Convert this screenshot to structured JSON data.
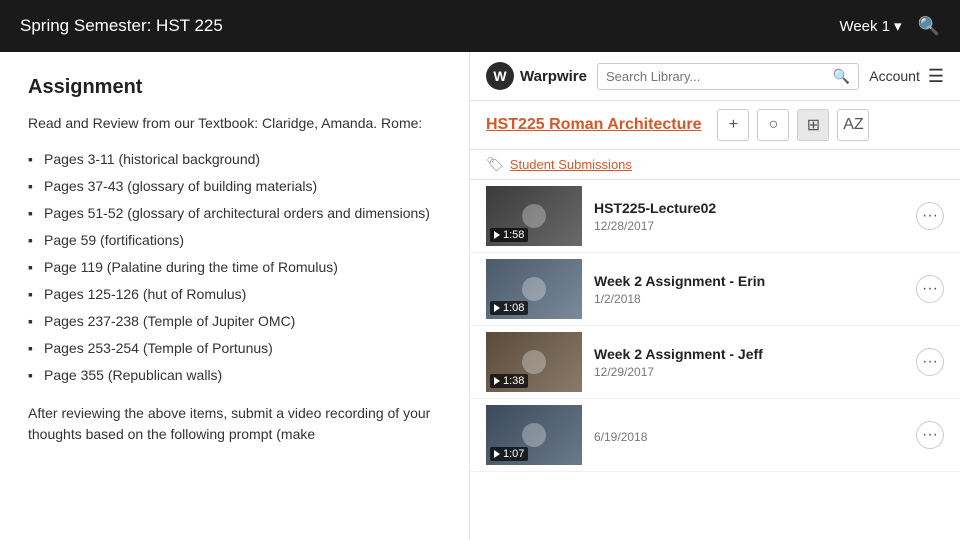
{
  "topbar": {
    "title": "Spring Semester: HST 225",
    "week_label": "Week 1",
    "chevron": "▾"
  },
  "assignment": {
    "heading": "Assignment",
    "intro": "Read and Review from our Textbook: Claridge, Amanda. Rome:",
    "pages": [
      "Pages 3-11 (historical background)",
      "Pages 37-43 (glossary of building materials)",
      "Pages 51-52 (glossary of architectural orders and dimensions)",
      "Page 59 (fortifications)",
      "Page 119 (Palatine during the time of Romulus)",
      "Pages 125-126 (hut of Romulus)",
      "Pages 237-238 (Temple of Jupiter OMC)",
      "Pages 253-254 (Temple of Portunus)",
      "Page 355 (Republican walls)"
    ],
    "footer": "After reviewing the above items, submit a video recording of your thoughts based on the following prompt (make"
  },
  "warpwire": {
    "logo_letter": "W",
    "logo_text": "Warpwire",
    "search_placeholder": "Search Library...",
    "account_label": "Account"
  },
  "library": {
    "title": "HST225 Roman Architecture",
    "add_btn": "+",
    "circle_btn": "○",
    "grid_btn": "⊞",
    "az_btn": "AZ",
    "tag_icon": "🏷",
    "tag_label": "Student Submissions",
    "videos": [
      {
        "title": "HST225-Lecture02",
        "date": "12/28/2017",
        "duration": "1:58",
        "thumb_class": "thumb-1"
      },
      {
        "title": "Week 2 Assignment - Erin",
        "date": "1/2/2018",
        "duration": "1:08",
        "thumb_class": "thumb-2"
      },
      {
        "title": "Week 2 Assignment - Jeff",
        "date": "12/29/2017",
        "duration": "1:38",
        "thumb_class": "thumb-3"
      },
      {
        "title": "",
        "date": "6/19/2018",
        "duration": "1:07",
        "thumb_class": "thumb-4"
      }
    ]
  }
}
